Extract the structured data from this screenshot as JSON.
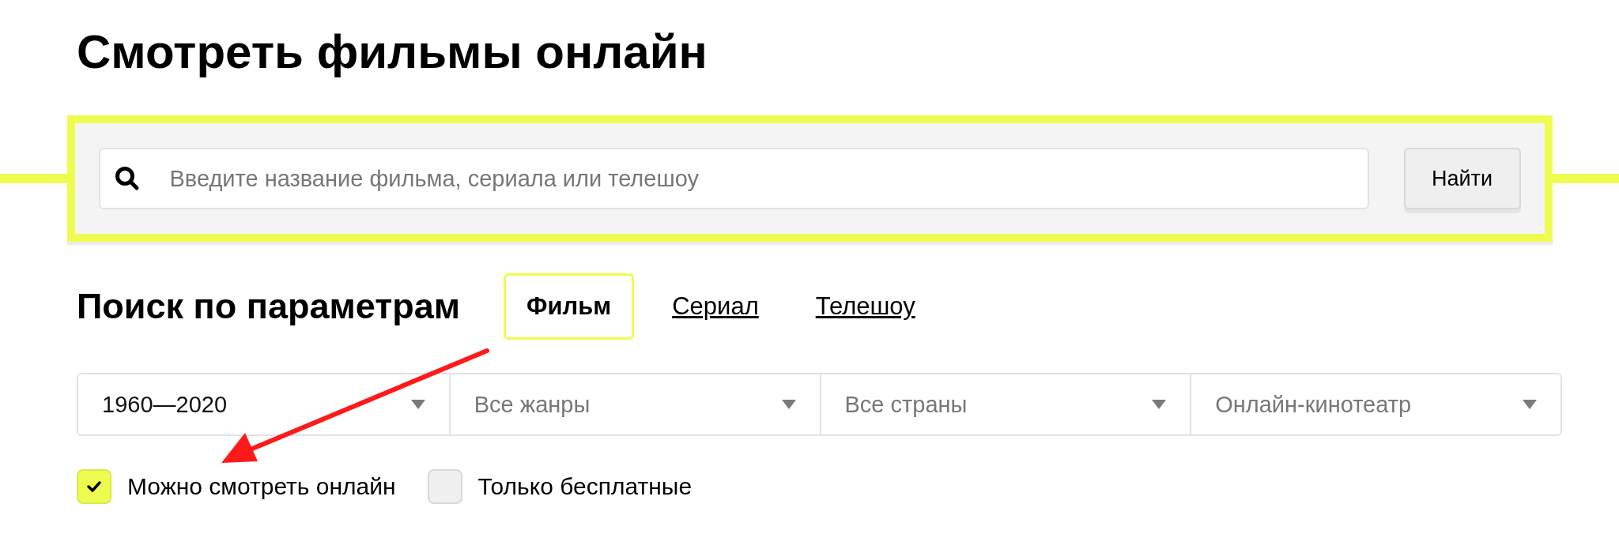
{
  "title": "Смотреть фильмы онлайн",
  "search": {
    "placeholder": "Введите название фильма, сериала или телешоу",
    "button": "Найти"
  },
  "filters": {
    "heading": "Поиск по параметрам",
    "tabs": [
      {
        "label": "Фильм",
        "selected": true
      },
      {
        "label": "Сериал",
        "selected": false
      },
      {
        "label": "Телешоу",
        "selected": false
      }
    ],
    "dropdowns": [
      {
        "value": "1960—2020"
      },
      {
        "placeholder": "Все жанры"
      },
      {
        "placeholder": "Все страны"
      },
      {
        "placeholder": "Онлайн-кинотеатр"
      }
    ],
    "checkboxes": [
      {
        "label": "Можно смотреть онлайн",
        "checked": true
      },
      {
        "label": "Только бесплатные",
        "checked": false
      }
    ]
  }
}
